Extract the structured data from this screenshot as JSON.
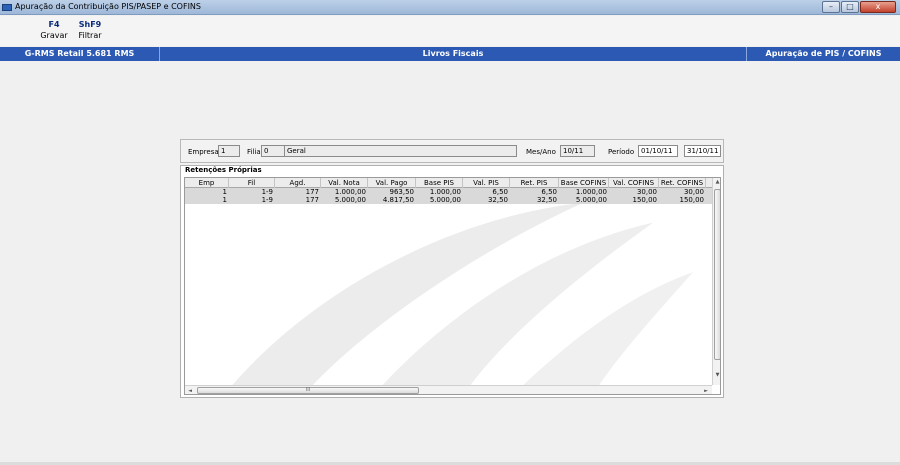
{
  "window": {
    "title": "Apuração da Contribuição PIS/PASEP e COFINS",
    "controls": {
      "minimize": "–",
      "maximize": "□",
      "close": "x"
    }
  },
  "toolbar": {
    "buttons": [
      {
        "key": "F4",
        "label": "Gravar"
      },
      {
        "key": "ShF9",
        "label": "Filtrar"
      }
    ]
  },
  "header": {
    "left": "G-RMS Retail 5.681 RMS",
    "center": "Livros Fiscais",
    "right": "Apuração de PIS / COFINS"
  },
  "filters": {
    "empresa_label": "Empresa",
    "empresa_value": "1",
    "filial_label": "Filial",
    "filial_value": "0",
    "filial_name": "Geral",
    "mesano_label": "Mes/Ano",
    "mesano_value": "10/11",
    "periodo_label": "Período",
    "periodo_start": "01/10/11",
    "periodo_end": "31/10/11"
  },
  "panel": {
    "title": "Retenções Próprias",
    "columns": [
      "Emp",
      "Fil",
      "Agd.",
      "Val. Nota",
      "Val. Pago",
      "Base PIS",
      "Val. PIS",
      "Ret. PIS",
      "Base COFINS",
      "Val. COFINS",
      "Ret. COFINS"
    ],
    "rows": [
      [
        "1",
        "1-9",
        "177",
        "1.000,00",
        "963,50",
        "1.000,00",
        "6,50",
        "6,50",
        "1.000,00",
        "30,00",
        "30,00"
      ],
      [
        "1",
        "1-9",
        "177",
        "5.000,00",
        "4.817,50",
        "5.000,00",
        "32,50",
        "32,50",
        "5.000,00",
        "150,00",
        "150,00"
      ]
    ],
    "scroll": {
      "up": "▲",
      "down": "▼",
      "left": "◄",
      "right": "►",
      "thumb": "III"
    }
  }
}
